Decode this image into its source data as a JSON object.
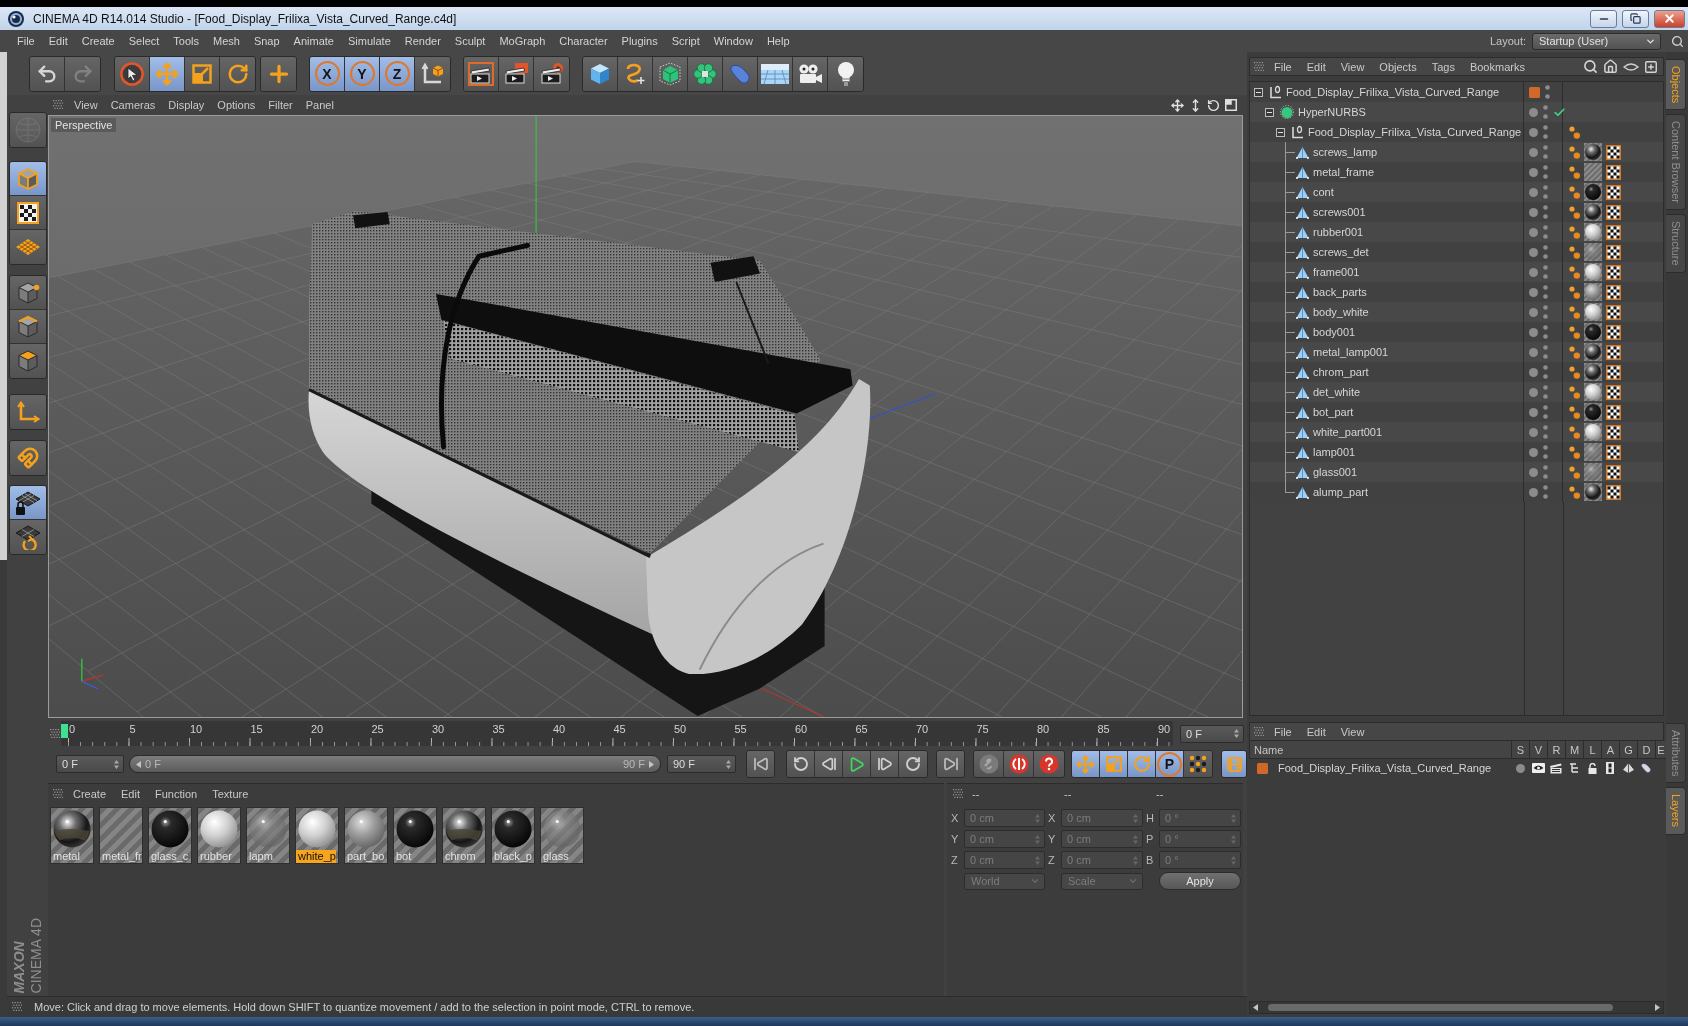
{
  "window": {
    "title": "CINEMA 4D R14.014 Studio - [Food_Display_Frilixa_Vista_Curved_Range.c4d]"
  },
  "menu_bar": [
    "File",
    "Edit",
    "Create",
    "Select",
    "Tools",
    "Mesh",
    "Snap",
    "Animate",
    "Simulate",
    "Render",
    "Sculpt",
    "MoGraph",
    "Character",
    "Plugins",
    "Script",
    "Window",
    "Help"
  ],
  "layout": {
    "label": "Layout:",
    "value": "Startup (User)"
  },
  "toolbar": {
    "groups": [
      {
        "tools": [
          {
            "selected": false,
            "disabled": false
          },
          {
            "selected": false,
            "disabled": true
          }
        ]
      },
      {
        "tools": [
          {
            "selected": false
          },
          {
            "selected": true
          },
          {
            "selected": false
          },
          {
            "selected": false
          }
        ]
      },
      {
        "tools": [
          {
            "selected": false
          }
        ]
      },
      {
        "tools": [
          {
            "label": "X",
            "selected": true
          },
          {
            "label": "Y",
            "selected": true
          },
          {
            "label": "Z",
            "selected": true
          },
          {
            "selected": false
          }
        ]
      },
      {
        "tools": [
          {
            "selected": false
          },
          {
            "selected": false
          },
          {
            "selected": false
          }
        ]
      },
      {
        "tools": [
          {
            "selected": false
          },
          {
            "selected": false
          },
          {
            "selected": false
          },
          {
            "selected": false
          },
          {
            "selected": false
          },
          {
            "selected": false
          },
          {
            "selected": false
          },
          {
            "selected": false
          }
        ]
      }
    ]
  },
  "mode_tools": {
    "groups": [
      {
        "tools": [
          {
            "selected": false,
            "disabled": true
          }
        ]
      },
      {
        "tools": [
          {
            "selected": true
          },
          {
            "selected": false
          },
          {
            "selected": false
          }
        ]
      },
      {
        "tools": [
          {
            "selected": false
          },
          {
            "selected": false
          },
          {
            "selected": false
          }
        ]
      },
      {
        "tools": [
          {
            "selected": false
          }
        ]
      },
      {
        "tools": [
          {
            "selected": false
          }
        ]
      },
      {
        "tools": [
          {
            "selected": true
          },
          {
            "selected": false
          }
        ]
      }
    ]
  },
  "viewport": {
    "menu": [
      "View",
      "Cameras",
      "Display",
      "Options",
      "Filter",
      "Panel"
    ],
    "label": "Perspective"
  },
  "timeline": {
    "ticks": [
      "0",
      "5",
      "10",
      "15",
      "20",
      "25",
      "30",
      "35",
      "40",
      "45",
      "50",
      "55",
      "60",
      "65",
      "70",
      "75",
      "80",
      "85",
      "90"
    ],
    "playhead": {
      "level": 0
    },
    "current_frame": "0 F",
    "start_frame": "0 F",
    "range": {
      "start": "0 F",
      "end": "90 F",
      "level": 1
    },
    "end_frame": "90 F",
    "key_tools": [
      {
        "selected": true
      },
      {
        "selected": true
      },
      {
        "selected": true
      },
      {
        "label": "P",
        "selected": true
      },
      {
        "selected": false
      }
    ],
    "timeline_button": {
      "selected": true
    }
  },
  "materials": {
    "menu": [
      "Create",
      "Edit",
      "Function",
      "Texture"
    ],
    "items": [
      {
        "name": "metal",
        "kind": "chrome",
        "selected": false
      },
      {
        "name": "metal_fr",
        "kind": "none",
        "selected": false
      },
      {
        "name": "glass_c",
        "kind": "black",
        "selected": false
      },
      {
        "name": "rubber",
        "kind": "light",
        "selected": false
      },
      {
        "name": "lapm",
        "kind": "glass",
        "selected": false
      },
      {
        "name": "white_p",
        "kind": "light",
        "selected": true
      },
      {
        "name": "part_bo",
        "kind": "grey",
        "selected": false
      },
      {
        "name": "bot",
        "kind": "black",
        "selected": false
      },
      {
        "name": "chrom",
        "kind": "chrome",
        "selected": false
      },
      {
        "name": "black_p",
        "kind": "black",
        "selected": false
      },
      {
        "name": "glass",
        "kind": "glass",
        "selected": false
      }
    ]
  },
  "coordinates": {
    "headers": [
      "--",
      "--",
      "--"
    ],
    "rows": [
      {
        "fields": [
          {
            "axis": "X",
            "value": "0 cm",
            "disabled": true
          },
          {
            "axis": "X",
            "value": "0 cm",
            "disabled": true
          },
          {
            "axis": "H",
            "value": "0 °",
            "disabled": true
          }
        ]
      },
      {
        "fields": [
          {
            "axis": "Y",
            "value": "0 cm",
            "disabled": true
          },
          {
            "axis": "Y",
            "value": "0 cm",
            "disabled": true
          },
          {
            "axis": "P",
            "value": "0 °",
            "disabled": true
          }
        ]
      },
      {
        "fields": [
          {
            "axis": "Z",
            "value": "0 cm",
            "disabled": true
          },
          {
            "axis": "Z",
            "value": "0 cm",
            "disabled": true
          },
          {
            "axis": "B",
            "value": "0 °",
            "disabled": true
          }
        ]
      }
    ],
    "dropdowns": [
      {
        "value": "World",
        "disabled": true
      },
      {
        "value": "Scale",
        "disabled": true
      }
    ],
    "apply": "Apply"
  },
  "status_bar": "Move: Click and drag to move elements. Hold down SHIFT to quantize movement / add to the selection in point mode, CTRL to remove.",
  "objects": {
    "menu": [
      "File",
      "Edit",
      "View",
      "Objects",
      "Tags",
      "Bookmarks"
    ],
    "tree": [
      {
        "name": "Food_Display_Frilixa_Vista_Curved_Range",
        "kind": "null",
        "expanded": true,
        "color": "#d2672a",
        "children": [
          {
            "name": "HyperNURBS",
            "kind": "nurbs",
            "expanded": true,
            "enabled": true,
            "children": [
              {
                "name": "Food_Display_Frilixa_Vista_Curved_Range",
                "kind": "null",
                "expanded": true,
                "tags": [
                  {
                    "kind": "dots"
                  }
                ],
                "children": [
                  {
                    "name": "screws_lamp",
                    "kind": "polygon",
                    "tags": [
                      {
                        "kind": "dots"
                      },
                      {
                        "kind": "material",
                        "preview": {
                          "kind": "chrome"
                        }
                      },
                      {
                        "kind": "uvw"
                      }
                    ]
                  },
                  {
                    "name": "metal_frame",
                    "kind": "polygon",
                    "tags": [
                      {
                        "kind": "dots"
                      },
                      {
                        "kind": "material",
                        "preview": {
                          "kind": "none"
                        }
                      },
                      {
                        "kind": "uvw"
                      }
                    ]
                  },
                  {
                    "name": "cont",
                    "kind": "polygon",
                    "tags": [
                      {
                        "kind": "dots"
                      },
                      {
                        "kind": "material",
                        "preview": {
                          "kind": "black"
                        }
                      },
                      {
                        "kind": "uvw"
                      }
                    ]
                  },
                  {
                    "name": "screws001",
                    "kind": "polygon",
                    "tags": [
                      {
                        "kind": "dots"
                      },
                      {
                        "kind": "material",
                        "preview": {
                          "kind": "chrome"
                        }
                      },
                      {
                        "kind": "uvw"
                      }
                    ]
                  },
                  {
                    "name": "rubber001",
                    "kind": "polygon",
                    "tags": [
                      {
                        "kind": "dots"
                      },
                      {
                        "kind": "material",
                        "preview": {
                          "kind": "light"
                        }
                      },
                      {
                        "kind": "uvw"
                      }
                    ]
                  },
                  {
                    "name": "screws_det",
                    "kind": "polygon",
                    "tags": [
                      {
                        "kind": "dots"
                      },
                      {
                        "kind": "material",
                        "preview": {
                          "kind": "glass"
                        }
                      },
                      {
                        "kind": "uvw"
                      }
                    ]
                  },
                  {
                    "name": "frame001",
                    "kind": "polygon",
                    "tags": [
                      {
                        "kind": "dots"
                      },
                      {
                        "kind": "material",
                        "preview": {
                          "kind": "light"
                        }
                      },
                      {
                        "kind": "uvw"
                      }
                    ]
                  },
                  {
                    "name": "back_parts",
                    "kind": "polygon",
                    "tags": [
                      {
                        "kind": "dots"
                      },
                      {
                        "kind": "material",
                        "preview": {
                          "kind": "grey"
                        }
                      },
                      {
                        "kind": "uvw"
                      }
                    ]
                  },
                  {
                    "name": "body_white",
                    "kind": "polygon",
                    "tags": [
                      {
                        "kind": "dots"
                      },
                      {
                        "kind": "material",
                        "preview": {
                          "kind": "light"
                        }
                      },
                      {
                        "kind": "uvw"
                      }
                    ]
                  },
                  {
                    "name": "body001",
                    "kind": "polygon",
                    "tags": [
                      {
                        "kind": "dots"
                      },
                      {
                        "kind": "material",
                        "preview": {
                          "kind": "black"
                        }
                      },
                      {
                        "kind": "uvw"
                      }
                    ]
                  },
                  {
                    "name": "metal_lamp001",
                    "kind": "polygon",
                    "tags": [
                      {
                        "kind": "dots"
                      },
                      {
                        "kind": "material",
                        "preview": {
                          "kind": "chrome"
                        }
                      },
                      {
                        "kind": "uvw"
                      }
                    ]
                  },
                  {
                    "name": "chrom_part",
                    "kind": "polygon",
                    "tags": [
                      {
                        "kind": "dots"
                      },
                      {
                        "kind": "material",
                        "preview": {
                          "kind": "chrome"
                        }
                      },
                      {
                        "kind": "uvw"
                      }
                    ]
                  },
                  {
                    "name": "det_white",
                    "kind": "polygon",
                    "tags": [
                      {
                        "kind": "dots"
                      },
                      {
                        "kind": "material",
                        "preview": {
                          "kind": "light"
                        }
                      },
                      {
                        "kind": "uvw"
                      }
                    ]
                  },
                  {
                    "name": "bot_part",
                    "kind": "polygon",
                    "tags": [
                      {
                        "kind": "dots"
                      },
                      {
                        "kind": "material",
                        "preview": {
                          "kind": "black"
                        }
                      },
                      {
                        "kind": "uvw"
                      }
                    ]
                  },
                  {
                    "name": "white_part001",
                    "kind": "polygon",
                    "tags": [
                      {
                        "kind": "dots"
                      },
                      {
                        "kind": "material",
                        "preview": {
                          "kind": "light"
                        }
                      },
                      {
                        "kind": "uvw"
                      }
                    ]
                  },
                  {
                    "name": "lamp001",
                    "kind": "polygon",
                    "tags": [
                      {
                        "kind": "dots"
                      },
                      {
                        "kind": "material",
                        "preview": {
                          "kind": "glass"
                        }
                      },
                      {
                        "kind": "uvw"
                      }
                    ]
                  },
                  {
                    "name": "glass001",
                    "kind": "polygon",
                    "tags": [
                      {
                        "kind": "dots"
                      },
                      {
                        "kind": "material",
                        "preview": {
                          "kind": "glass"
                        }
                      },
                      {
                        "kind": "uvw"
                      }
                    ]
                  },
                  {
                    "name": "alump_part",
                    "kind": "polygon",
                    "tags": [
                      {
                        "kind": "dots"
                      },
                      {
                        "kind": "material",
                        "preview": {
                          "kind": "chrome"
                        }
                      },
                      {
                        "kind": "uvw"
                      }
                    ]
                  }
                ]
              }
            ]
          }
        ]
      }
    ]
  },
  "layers": {
    "menu": [
      "File",
      "Edit",
      "View"
    ],
    "columns": [
      "Name",
      "S",
      "V",
      "R",
      "M",
      "L",
      "A",
      "G",
      "D",
      "E"
    ],
    "rows": [
      {
        "name": "Food_Display_Frilixa_Vista_Curved_Range",
        "color": "#d2672a"
      }
    ]
  },
  "side_tabs": {
    "upper": [
      {
        "label": "Objects",
        "selected": true
      },
      {
        "label": "Content Browser",
        "selected": false
      },
      {
        "label": "Structure",
        "selected": false
      }
    ],
    "lower": [
      {
        "label": "Attributes",
        "selected": false
      },
      {
        "label": "Layers",
        "selected": true
      }
    ]
  },
  "logo": {
    "brand": "MAXON",
    "product": "CINEMA 4D"
  }
}
